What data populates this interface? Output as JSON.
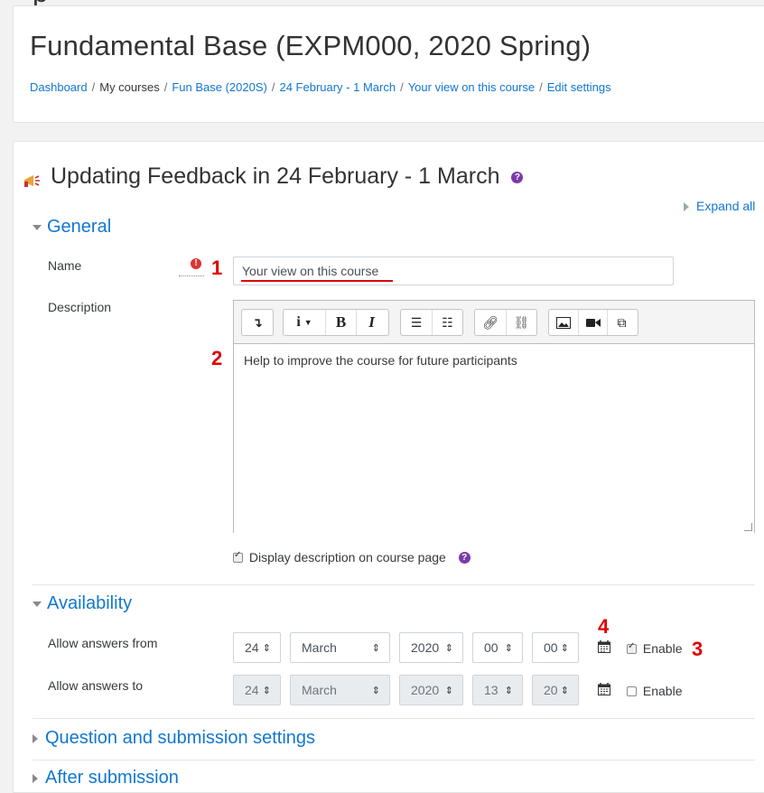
{
  "top_partial_text": "p",
  "header": {
    "course_title": "Fundamental Base (EXPM000, 2020 Spring)",
    "breadcrumbs": [
      "Dashboard",
      "My courses",
      "Fun Base (2020S)",
      "24 February - 1 March",
      "Your view on this course",
      "Edit settings"
    ],
    "breadcrumb_separator": "/"
  },
  "page": {
    "heading": "Updating Feedback in 24 February - 1 March",
    "expand_all": "Expand all"
  },
  "general": {
    "title": "General",
    "name_label": "Name",
    "name_value": "Your view on this course",
    "description_label": "Description",
    "description_text": "Help to improve the course for future participants",
    "display_description_label": "Display description on course page",
    "display_description_checked": true
  },
  "availability": {
    "title": "Availability",
    "rows": [
      {
        "label": "Allow answers from",
        "day": "24",
        "month": "March",
        "year": "2020",
        "hour": "00",
        "minute": "00",
        "enable_label": "Enable",
        "enabled": true
      },
      {
        "label": "Allow answers to",
        "day": "24",
        "month": "March",
        "year": "2020",
        "hour": "13",
        "minute": "20",
        "enable_label": "Enable",
        "enabled": false
      }
    ]
  },
  "collapsed_sections": [
    "Question and submission settings",
    "After submission"
  ],
  "annotations": [
    "1",
    "2",
    "3",
    "4"
  ],
  "colors": {
    "link": "#1177d1",
    "annotation": "#e00000",
    "help": "#7c3aa8"
  },
  "icons": [
    "feedback-megaphone-icon",
    "help-icon",
    "required-icon",
    "calendar-icon",
    "chevron-down-icon",
    "chevron-right-icon",
    "select-arrow-icon"
  ]
}
